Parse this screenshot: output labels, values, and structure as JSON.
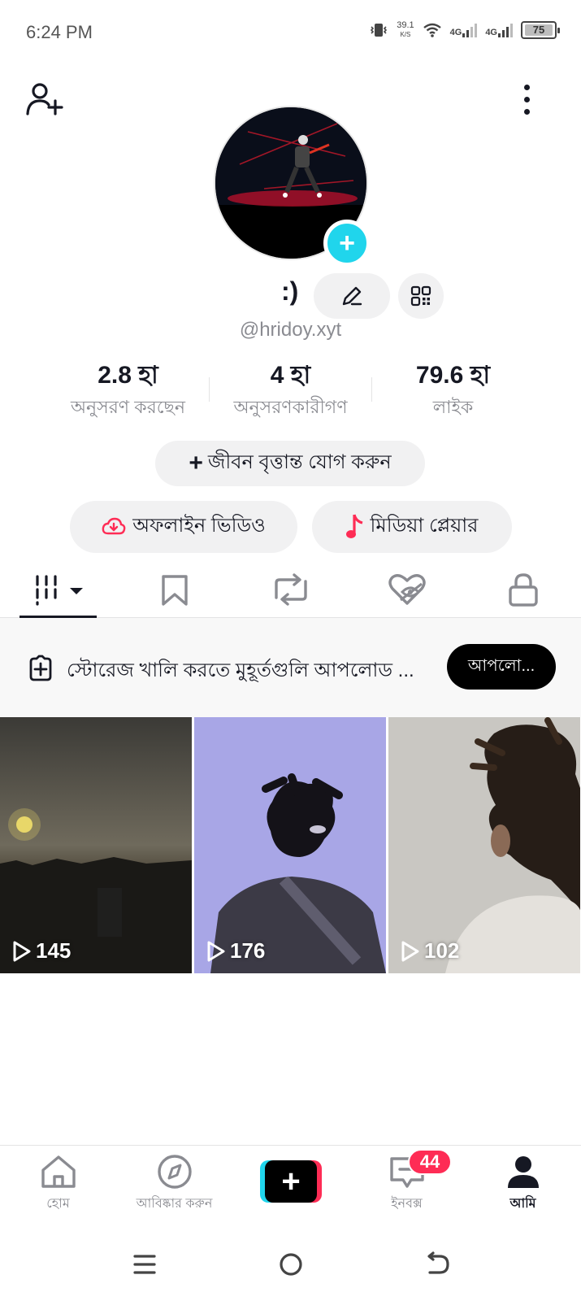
{
  "status_bar": {
    "time": "6:24 PM",
    "net_speed": "39.1",
    "net_unit": "K/S",
    "sim1": "4G",
    "sim2": "4G",
    "battery": "75"
  },
  "profile": {
    "nickname": ":)",
    "username": "@hridoy.xyt",
    "avatar_icon": "profile-photo-dancer"
  },
  "stats": [
    {
      "value": "2.8 হা",
      "label": "অনুসরণ করছেন"
    },
    {
      "value": "4 হা",
      "label": "অনুসরণকারীগণ"
    },
    {
      "value": "79.6 হা",
      "label": "লাইক"
    }
  ],
  "bio_button": {
    "icon": "+",
    "label": "জীবন বৃত্তান্ত যোগ করুন"
  },
  "shortcuts": [
    {
      "label": "অফলাইন ভিডিও",
      "icon": "cloud-download-icon"
    },
    {
      "label": "মিডিয়া প্লেয়ার",
      "icon": "music-note-icon"
    }
  ],
  "tabs": [
    "videos-grid",
    "favorites",
    "reposts",
    "liked",
    "private"
  ],
  "upload_banner": {
    "text": "স্টোরেজ খালি করতে মুহূর্তগুলি আপলোড ...",
    "button": "আপলো..."
  },
  "videos": [
    {
      "views": "145",
      "theme": "sunset"
    },
    {
      "views": "176",
      "theme": "blurred-portrait"
    },
    {
      "views": "102",
      "theme": "hair-silhouette"
    }
  ],
  "bottom_nav": {
    "home": "হোম",
    "discover": "আবিষ্কার করুন",
    "inbox": "ইনবক্স",
    "inbox_badge": "44",
    "me": "আমি"
  },
  "colors": {
    "accent_cyan": "#20d5ec",
    "accent_red": "#fe2c55",
    "text_primary": "#161823",
    "text_secondary": "#8a8b91"
  }
}
